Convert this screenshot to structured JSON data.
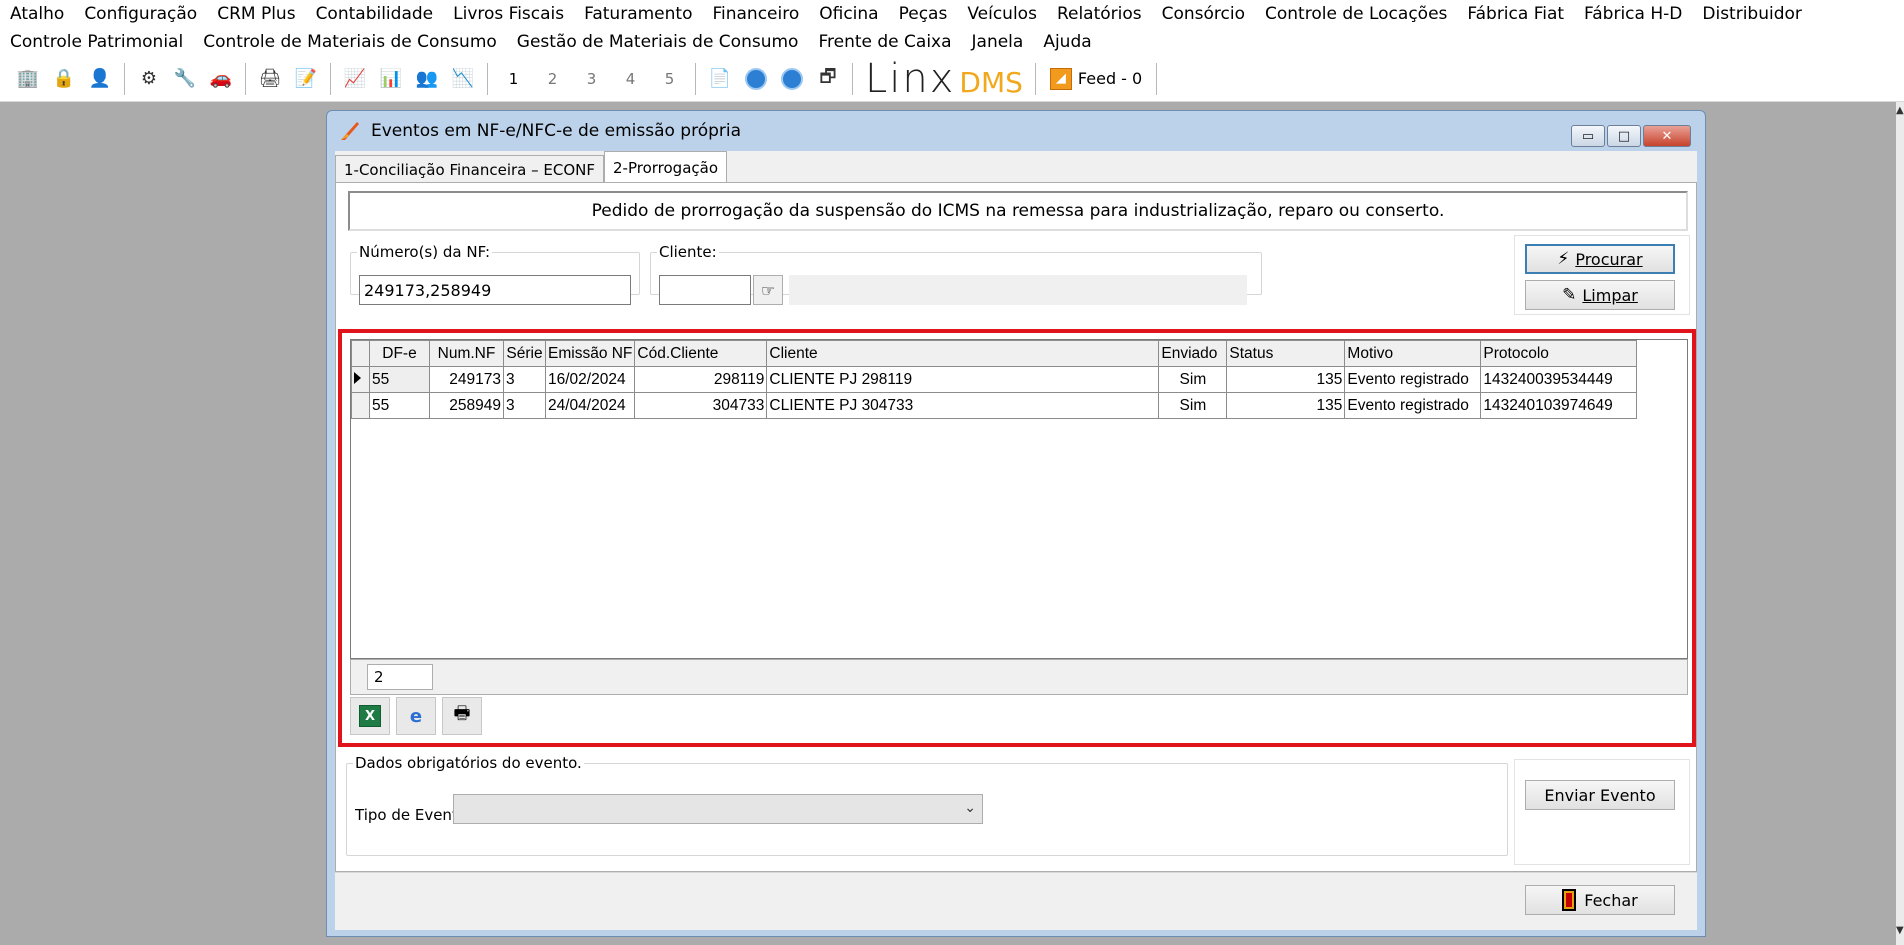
{
  "menu": {
    "row1": [
      "Atalho",
      "Configuração",
      "CRM Plus",
      "Contabilidade",
      "Livros Fiscais",
      "Faturamento",
      "Financeiro",
      "Oficina",
      "Peças",
      "Veículos",
      "Relatórios",
      "Consórcio",
      "Controle de Locações",
      "Fábrica Fiat",
      "Fábrica H-D",
      "Distribuidor"
    ],
    "row2": [
      "Controle Patrimonial",
      "Controle de Materiais de Consumo",
      "Gestão de Materiais de Consumo",
      "Frente de Caixa",
      "Janela",
      "Ajuda"
    ]
  },
  "toolbar": {
    "window_numbers": [
      "1",
      "2",
      "3",
      "4",
      "5"
    ],
    "brand": {
      "main": "Linx",
      "sub": "DMS"
    },
    "feed_label": "Feed - 0"
  },
  "window": {
    "title": "Eventos em NF-e/NFC-e de emissão própria",
    "controls": {
      "minimize": "▭",
      "maximize": "□",
      "close": "✕"
    }
  },
  "tabs": [
    {
      "label": "1-Conciliação Financeira – ECONF",
      "active": false
    },
    {
      "label": "2-Prorrogação",
      "active": true
    }
  ],
  "header_text": "Pedido de prorrogação da suspensão do ICMS na remessa para industrialização, reparo ou conserto.",
  "filters": {
    "nf_label": "Número(s) da NF:",
    "nf_value": "249173,258949",
    "cliente_label": "Cliente:",
    "cliente_value": "",
    "cliente_name": ""
  },
  "buttons": {
    "procurar": "Procurar",
    "limpar": "Limpar",
    "enviar": "Enviar Evento",
    "fechar": "Fechar"
  },
  "grid": {
    "columns": [
      "DF-e",
      "Num.NF",
      "Série",
      "Emissão NF",
      "Cód.Cliente",
      "Cliente",
      "Enviado",
      "Status",
      "Motivo",
      "Protocolo"
    ],
    "rows": [
      [
        "55",
        "249173",
        "3",
        "16/02/2024",
        "298119",
        "CLIENTE PJ 298119",
        "Sim",
        "135",
        "Evento registrado",
        "143240039534449"
      ],
      [
        "55",
        "258949",
        "3",
        "24/04/2024",
        "304733",
        "CLIENTE PJ 304733",
        "Sim",
        "135",
        "Evento registrado",
        "143240103974649"
      ]
    ],
    "record_count": "2",
    "selected_row": 0
  },
  "export_icons": [
    "excel-icon",
    "internet-explorer-icon",
    "printer-icon"
  ],
  "dados": {
    "legend": "Dados obrigatórios do evento.",
    "tipo_label": "Tipo de Evento:",
    "tipo_value": ""
  },
  "colors": {
    "highlight": "#e0141c",
    "window_frame": "#bcd2ea",
    "brand_accent": "#f2a81d"
  }
}
